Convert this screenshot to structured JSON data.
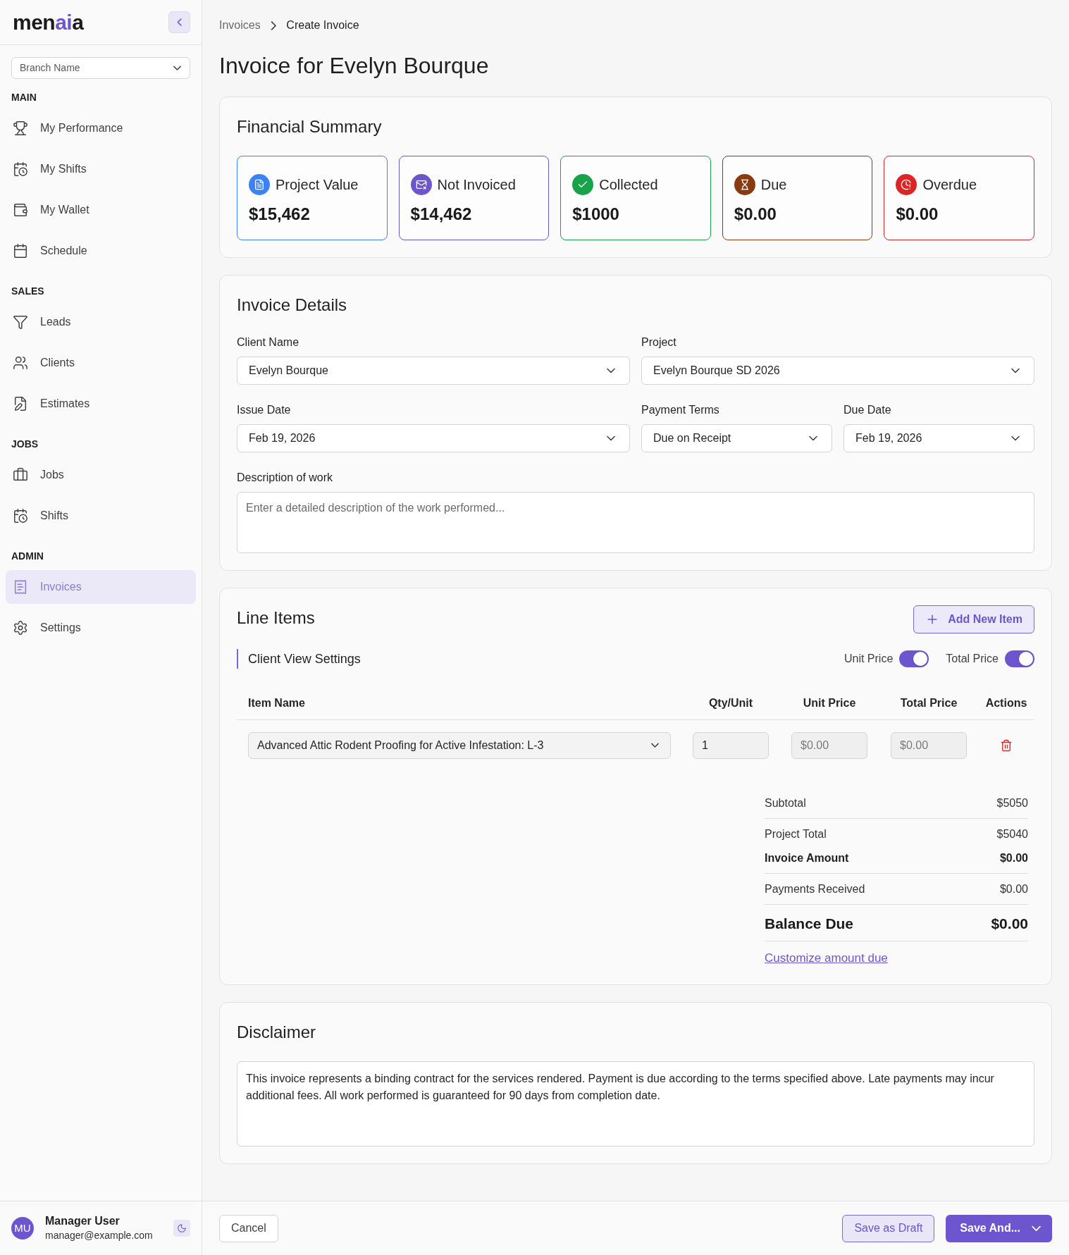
{
  "sidebar": {
    "logo": [
      {
        "text": "men",
        "accent": false
      },
      {
        "text": "ai",
        "accent": true
      },
      {
        "text": "a",
        "accent": false
      }
    ],
    "branch_select": {
      "placeholder": "Branch Name"
    },
    "sections": [
      {
        "label": "MAIN",
        "items": [
          {
            "label": "My Performance",
            "selected": false
          },
          {
            "label": "My Shifts",
            "selected": false
          },
          {
            "label": "My Wallet",
            "selected": false
          },
          {
            "label": "Schedule",
            "selected": false
          }
        ]
      },
      {
        "label": "SALES",
        "items": [
          {
            "label": "Leads",
            "selected": false
          },
          {
            "label": "Clients",
            "selected": false
          },
          {
            "label": "Estimates",
            "selected": false
          }
        ]
      },
      {
        "label": "JOBS",
        "items": [
          {
            "label": "Jobs",
            "selected": false
          },
          {
            "label": "Shifts",
            "selected": false
          }
        ]
      },
      {
        "label": "ADMIN",
        "items": [
          {
            "label": "Invoices",
            "selected": true
          },
          {
            "label": "Settings",
            "selected": false
          }
        ]
      }
    ],
    "user": {
      "initials": "MU",
      "name": "Manager User",
      "email": "manager@example.com"
    }
  },
  "breadcrumb": [
    {
      "label": "Invoices",
      "current": false
    },
    {
      "label": "Create Invoice",
      "current": true
    }
  ],
  "title": "Invoice for Evelyn Bourque",
  "financial_summary": {
    "title": "Financial Summary",
    "cards": [
      {
        "label": "Project Value",
        "value": "$15,462",
        "color": "#3b82f6"
      },
      {
        "label": "Not Invoiced",
        "value": "$14,462",
        "color": "#6d55cc"
      },
      {
        "label": "Collected",
        "value": "$1000",
        "color": "#16a34a"
      },
      {
        "label": "Due",
        "value": "$0.00",
        "color": "#8b3a10"
      },
      {
        "label": "Overdue",
        "value": "$0.00",
        "color": "#dc2626"
      }
    ]
  },
  "invoice_details": {
    "title": "Invoice Details",
    "fields": [
      {
        "label": "Client Name",
        "value": "Evelyn Bourque"
      },
      {
        "label": "Project",
        "value": "Evelyn Bourque SD 2026"
      },
      {
        "label": "Issue Date",
        "value": "Feb 19, 2026"
      },
      {
        "label": "Payment Terms",
        "value": "Due on Receipt"
      },
      {
        "label": "Due Date",
        "value": "Feb 19, 2026"
      }
    ],
    "description": {
      "label": "Description of work",
      "placeholder": "Enter a detailed description of the work performed..."
    }
  },
  "line_items": {
    "title": "Line Items",
    "add_button": "Add New Item",
    "client_view": {
      "title": "Client View Settings",
      "toggles": [
        {
          "label": "Unit Price",
          "on": true
        },
        {
          "label": "Total Price",
          "on": true
        }
      ]
    },
    "columns": [
      "Item Name",
      "Qty/Unit",
      "Unit Price",
      "Total Price",
      "Actions"
    ],
    "rows": [
      {
        "item": "Advanced Attic Rodent Proofing for Active Infestation: L-3",
        "qty": "1",
        "unit_price": {
          "placeholder": "$0.00"
        },
        "total_price": {
          "placeholder": "$0.00"
        }
      }
    ],
    "totals": [
      {
        "label": "Subtotal",
        "value": "$5050",
        "kind": "plain",
        "divider": true
      },
      {
        "label": "Project Total",
        "value": "$5040",
        "kind": "plain",
        "divider": false
      },
      {
        "label": "Invoice Amount",
        "value": "$0.00",
        "kind": "strong",
        "divider": true
      },
      {
        "label": "Payments Received",
        "value": "$0.00",
        "kind": "plain",
        "divider": true
      },
      {
        "label": "Balance Due",
        "value": "$0.00",
        "kind": "grand",
        "divider": true
      }
    ],
    "customize_link": "Customize amount due"
  },
  "disclaimer": {
    "title": "Disclaimer",
    "text": "This invoice represents a binding contract for the services rendered. Payment is due according to the terms specified above. Late payments may incur additional fees. All work performed is guaranteed for 90 days from completion date."
  },
  "footer": {
    "cancel": "Cancel",
    "save_draft": "Save as Draft",
    "save_and": "Save And..."
  }
}
